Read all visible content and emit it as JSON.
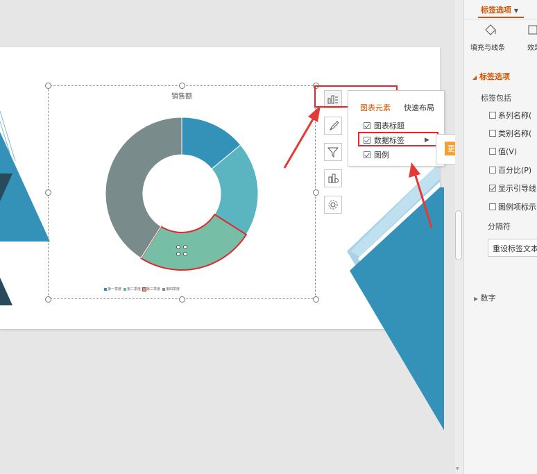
{
  "chart": {
    "title": "销售额",
    "legend": [
      "第一季度",
      "第二季度",
      "第三季度",
      "第四季度"
    ]
  },
  "chart_data": {
    "type": "pie",
    "title": "销售额",
    "categories": [
      "第一季度",
      "第二季度",
      "第三季度",
      "第四季度"
    ],
    "values": [
      14,
      20,
      25,
      41
    ],
    "colors": [
      "#3492b9",
      "#5ab5c0",
      "#76bea6",
      "#7a8b8c"
    ],
    "legend_position": "bottom",
    "selected_category": "第三季度"
  },
  "popup": {
    "tabs": [
      "图表元素",
      "快速布局"
    ],
    "items": [
      {
        "label": "图表标题",
        "checked": true
      },
      {
        "label": "数据标签",
        "checked": true,
        "has_submenu": true
      },
      {
        "label": "图例",
        "checked": true
      }
    ],
    "more_options": "更多选项..."
  },
  "pane": {
    "tab": "标签选项",
    "sub_tabs": [
      "填充与线条",
      "效果"
    ],
    "section": "标签选项",
    "group_label": "标签包括",
    "options": [
      {
        "label": "系列名称(",
        "checked": false
      },
      {
        "label": "类别名称(",
        "checked": false
      },
      {
        "label": "值(V)",
        "checked": false
      },
      {
        "label": "百分比(P)",
        "checked": false
      },
      {
        "label": "显示引导线",
        "checked": true
      },
      {
        "label": "图例项标示",
        "checked": false
      }
    ],
    "separator_label": "分隔符",
    "reset_button": "重设标签文本",
    "collapsed_section": "数字"
  },
  "colors": {
    "accent": "#e0292a",
    "tab_active": "#d35400",
    "more_button": "#f0a236"
  }
}
